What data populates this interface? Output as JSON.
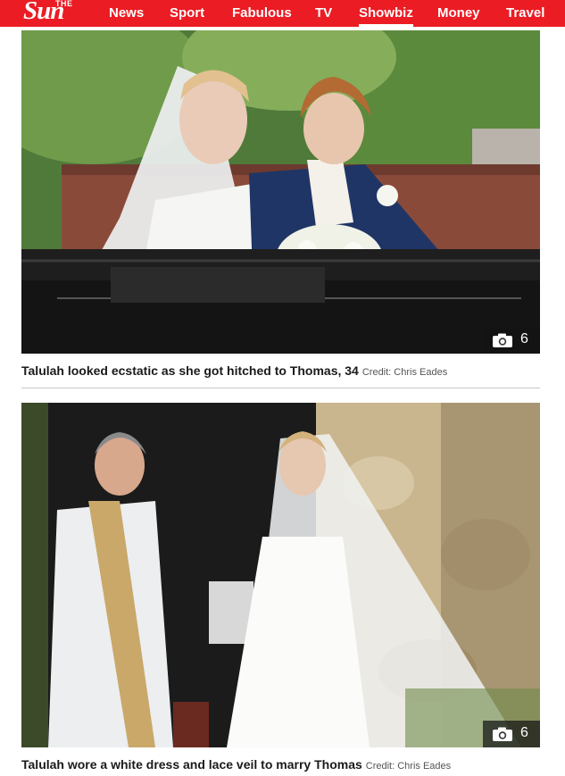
{
  "header": {
    "logo_the": "THE",
    "logo_sun": "Sun",
    "nav": [
      "News",
      "Sport",
      "Fabulous",
      "TV",
      "Showbiz",
      "Money",
      "Travel"
    ],
    "active_nav": "Showbiz",
    "brand_color": "#eb1c24"
  },
  "gallery": [
    {
      "photo_icon": "camera-icon",
      "photo_count": "6",
      "caption": "Talulah looked ecstatic as she got hitched to Thomas, 34",
      "credit": "Credit: Chris Eades"
    },
    {
      "photo_icon": "camera-icon",
      "photo_count": "6",
      "caption": "Talulah wore a white dress and lace veil to marry Thomas",
      "credit": "Credit: Chris Eades"
    }
  ]
}
